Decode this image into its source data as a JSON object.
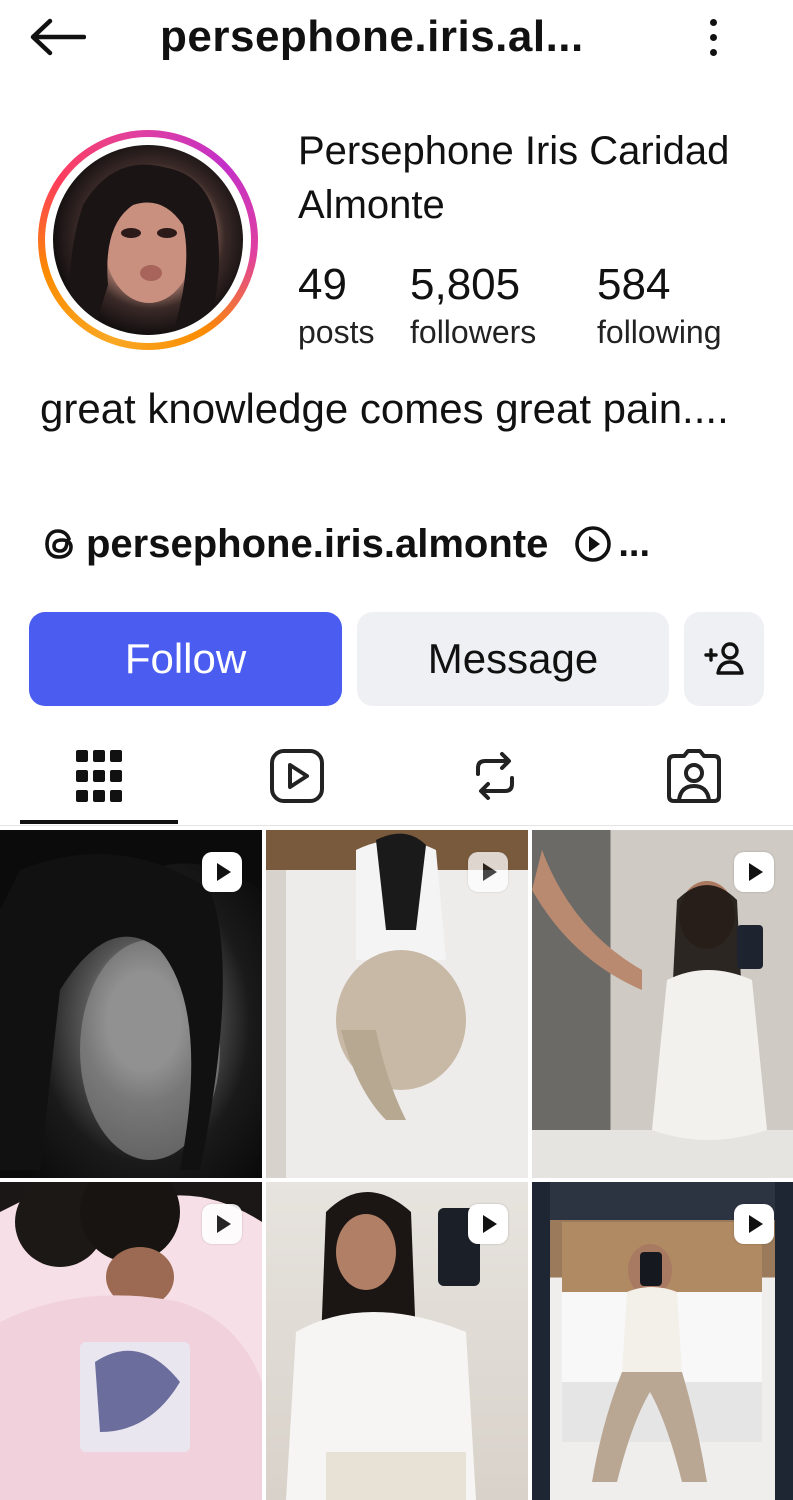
{
  "header": {
    "username": "persephone.iris.al..."
  },
  "profile": {
    "display_name": "Persephone Iris Caridad Almonte",
    "stats": [
      {
        "value": "49",
        "label": "posts"
      },
      {
        "value": "5,805",
        "label": "followers"
      },
      {
        "value": "584",
        "label": "following"
      }
    ],
    "bio": "great knowledge comes great pain....",
    "threads_handle": "persephone.iris.almonte",
    "more_links": "..."
  },
  "actions": {
    "follow_label": "Follow",
    "message_label": "Message"
  },
  "tabs": [
    {
      "icon": "grid-icon",
      "active": true
    },
    {
      "icon": "reels-icon",
      "active": false
    },
    {
      "icon": "reposts-icon",
      "active": false
    },
    {
      "icon": "tagged-icon",
      "active": false
    }
  ],
  "colors": {
    "follow_button": "#4a5df0",
    "secondary_button": "#eff0f3"
  },
  "posts": [
    {
      "type": "reel",
      "description": "black and white close-up portrait"
    },
    {
      "type": "reel",
      "description": "person posing on bed"
    },
    {
      "type": "reel",
      "description": "mirror selfie in white dress"
    },
    {
      "type": "reel",
      "description": "person in pink hoodie"
    },
    {
      "type": "reel",
      "description": "mirror selfie in white t-shirt"
    },
    {
      "type": "reel",
      "description": "mirror selfie in hotel room"
    }
  ]
}
